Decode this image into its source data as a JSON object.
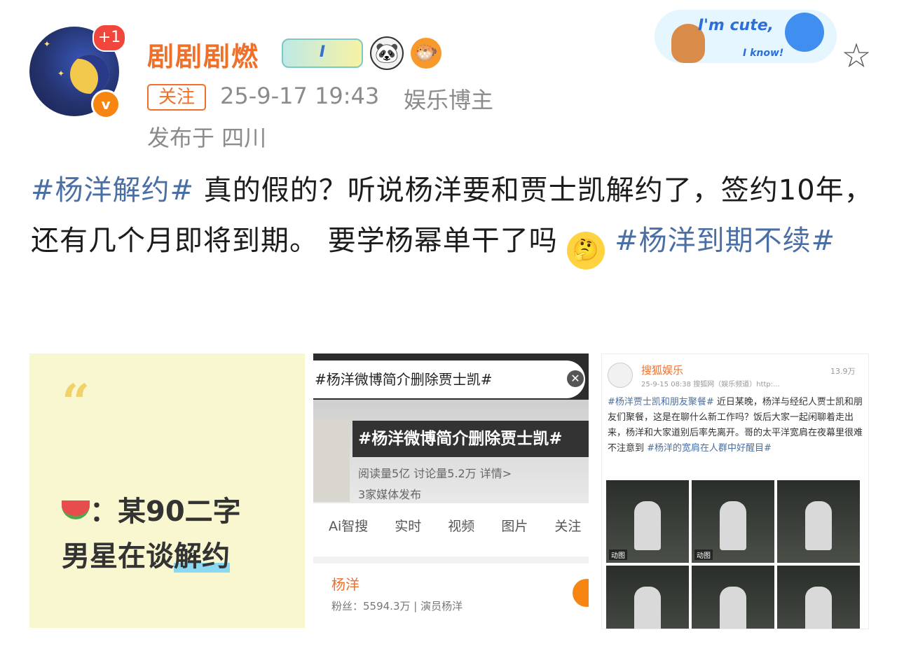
{
  "header": {
    "username": "剧剧剧燃",
    "avatar_badge": "+1",
    "verified_mark": "v",
    "level_badge": "I",
    "follow_label": "关注",
    "timestamp": "25-9-17 19:43",
    "role": "娱乐博主",
    "location": "发布于 四川"
  },
  "sticker": {
    "line1": "I'm cute,",
    "line2": "I know!"
  },
  "post": {
    "tag1": "#杨洋解约#",
    "text1": " 真的假的？听说杨洋要和贾士凯解约了，签约10年，还有几个月即将到期。 要学杨幂单干了吗",
    "tag2": " #杨洋到期不续#"
  },
  "image1": {
    "quote_mark": "“",
    "line1": "：某90二字",
    "line2_plain": "男星在谈",
    "line2_highlight": "解约"
  },
  "image2": {
    "search_text": "#杨洋微博简介删除贾士凯#",
    "close_glyph": "✕",
    "banner_title": "#杨洋微博简介删除贾士凯#",
    "stats": "阅读量5亿  讨论量5.2万  详情>",
    "media": "3家媒体发布",
    "tabs": [
      "Ai智搜",
      "实时",
      "视频",
      "图片",
      "关注"
    ],
    "user_name": "杨洋",
    "fans": "粉丝：5594.3万 | 演员杨洋"
  },
  "image3": {
    "account": "搜狐娱乐",
    "reads": "13.9万",
    "meta": "25-9-15 08:38  搜狐网（娱乐频道）http:...",
    "tag_start": "#杨洋贾士凯和朋友聚餐#",
    "body": " 近日某晚，杨洋与经纪人贾士凯和朋友们聚餐，这是在聊什么新工作吗？饭后大家一起闲聊着走出来，杨洋和大家道别后率先离开。哥的太平洋宽肩在夜幕里很难不注意到",
    "tag_end": " #杨洋的宽肩在人群中好醒目#",
    "cell_label": "动图"
  },
  "colors": {
    "brand_orange": "#f0702a",
    "topic_blue": "#4a6fa5",
    "meta_gray": "#8b8b8b"
  },
  "icons": [
    "avatar",
    "level-badge",
    "panda-icon",
    "fish-icon",
    "star-icon",
    "thinking-emoji",
    "watermelon-icon"
  ]
}
